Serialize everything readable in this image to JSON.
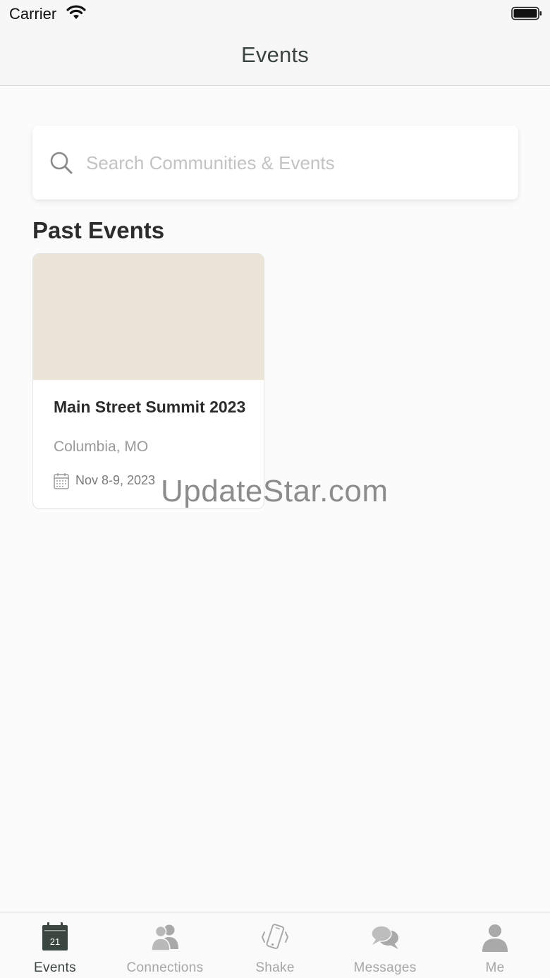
{
  "status_bar": {
    "carrier": "Carrier"
  },
  "nav": {
    "title": "Events"
  },
  "search": {
    "placeholder": "Search Communities & Events",
    "value": ""
  },
  "sections": [
    {
      "title": "Past Events",
      "events": [
        {
          "title": "Main Street Summit 2023",
          "location": "Columbia, MO",
          "date": "Nov 8-9, 2023"
        }
      ]
    }
  ],
  "watermark": "UpdateStar.com",
  "tab_bar": {
    "tabs": [
      {
        "label": "Events",
        "icon": "calendar-icon",
        "badge_text": "21",
        "active": true
      },
      {
        "label": "Connections",
        "icon": "people-icon",
        "active": false
      },
      {
        "label": "Shake",
        "icon": "shake-phone-icon",
        "active": false
      },
      {
        "label": "Messages",
        "icon": "chat-bubbles-icon",
        "active": false
      },
      {
        "label": "Me",
        "icon": "person-icon",
        "active": false
      }
    ]
  },
  "colors": {
    "accent": "#3b4640",
    "inactive": "#a6a6a6",
    "card_image_placeholder": "#ebe5d7"
  }
}
